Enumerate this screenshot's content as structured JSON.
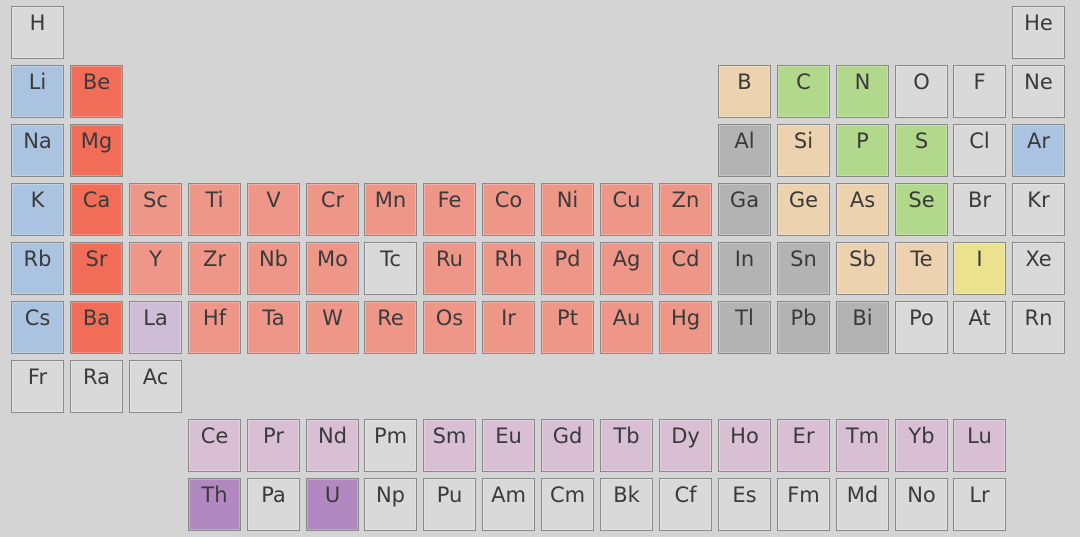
{
  "colors": {
    "none": "#d9d9d9",
    "alkali": "#a9c3e0",
    "alkaline_earth": "#f26d58",
    "transition": "#ee9688",
    "lanthanum": "#cfbcd6",
    "lanthanide": "#d9bfd4",
    "actinide_highlight": "#b288c0",
    "boron_group": "#ecd2af",
    "carbon_group": "#b2d88c",
    "metal_gray": "#b3b3b3",
    "halogen_yellow": "#eae28f",
    "noble_blue": "#a9c3e0"
  },
  "rows": [
    [
      [
        "H",
        "none"
      ],
      null,
      null,
      null,
      null,
      null,
      null,
      null,
      null,
      null,
      null,
      null,
      null,
      null,
      null,
      null,
      null,
      [
        "He",
        "none"
      ]
    ],
    [
      [
        "Li",
        "alkali"
      ],
      [
        "Be",
        "alkaline_earth"
      ],
      null,
      null,
      null,
      null,
      null,
      null,
      null,
      null,
      null,
      null,
      [
        "B",
        "boron_group"
      ],
      [
        "C",
        "carbon_group"
      ],
      [
        "N",
        "carbon_group"
      ],
      [
        "O",
        "none"
      ],
      [
        "F",
        "none"
      ],
      [
        "Ne",
        "none"
      ]
    ],
    [
      [
        "Na",
        "alkali"
      ],
      [
        "Mg",
        "alkaline_earth"
      ],
      null,
      null,
      null,
      null,
      null,
      null,
      null,
      null,
      null,
      null,
      [
        "Al",
        "metal_gray"
      ],
      [
        "Si",
        "boron_group"
      ],
      [
        "P",
        "carbon_group"
      ],
      [
        "S",
        "carbon_group"
      ],
      [
        "Cl",
        "none"
      ],
      [
        "Ar",
        "noble_blue"
      ]
    ],
    [
      [
        "K",
        "alkali"
      ],
      [
        "Ca",
        "alkaline_earth"
      ],
      [
        "Sc",
        "transition"
      ],
      [
        "Ti",
        "transition"
      ],
      [
        "V",
        "transition"
      ],
      [
        "Cr",
        "transition"
      ],
      [
        "Mn",
        "transition"
      ],
      [
        "Fe",
        "transition"
      ],
      [
        "Co",
        "transition"
      ],
      [
        "Ni",
        "transition"
      ],
      [
        "Cu",
        "transition"
      ],
      [
        "Zn",
        "transition"
      ],
      [
        "Ga",
        "metal_gray"
      ],
      [
        "Ge",
        "boron_group"
      ],
      [
        "As",
        "boron_group"
      ],
      [
        "Se",
        "carbon_group"
      ],
      [
        "Br",
        "none"
      ],
      [
        "Kr",
        "none"
      ]
    ],
    [
      [
        "Rb",
        "alkali"
      ],
      [
        "Sr",
        "alkaline_earth"
      ],
      [
        "Y",
        "transition"
      ],
      [
        "Zr",
        "transition"
      ],
      [
        "Nb",
        "transition"
      ],
      [
        "Mo",
        "transition"
      ],
      [
        "Tc",
        "none"
      ],
      [
        "Ru",
        "transition"
      ],
      [
        "Rh",
        "transition"
      ],
      [
        "Pd",
        "transition"
      ],
      [
        "Ag",
        "transition"
      ],
      [
        "Cd",
        "transition"
      ],
      [
        "In",
        "metal_gray"
      ],
      [
        "Sn",
        "metal_gray"
      ],
      [
        "Sb",
        "boron_group"
      ],
      [
        "Te",
        "boron_group"
      ],
      [
        "I",
        "halogen_yellow"
      ],
      [
        "Xe",
        "none"
      ]
    ],
    [
      [
        "Cs",
        "alkali"
      ],
      [
        "Ba",
        "alkaline_earth"
      ],
      [
        "La",
        "lanthanum"
      ],
      [
        "Hf",
        "transition"
      ],
      [
        "Ta",
        "transition"
      ],
      [
        "W",
        "transition"
      ],
      [
        "Re",
        "transition"
      ],
      [
        "Os",
        "transition"
      ],
      [
        "Ir",
        "transition"
      ],
      [
        "Pt",
        "transition"
      ],
      [
        "Au",
        "transition"
      ],
      [
        "Hg",
        "transition"
      ],
      [
        "Tl",
        "metal_gray"
      ],
      [
        "Pb",
        "metal_gray"
      ],
      [
        "Bi",
        "metal_gray"
      ],
      [
        "Po",
        "none"
      ],
      [
        "At",
        "none"
      ],
      [
        "Rn",
        "none"
      ]
    ],
    [
      [
        "Fr",
        "none"
      ],
      [
        "Ra",
        "none"
      ],
      [
        "Ac",
        "none"
      ],
      null,
      null,
      null,
      null,
      null,
      null,
      null,
      null,
      null,
      null,
      null,
      null,
      null,
      null,
      null
    ],
    [
      null,
      null,
      null,
      [
        "Ce",
        "lanthanide"
      ],
      [
        "Pr",
        "lanthanide"
      ],
      [
        "Nd",
        "lanthanide"
      ],
      [
        "Pm",
        "none"
      ],
      [
        "Sm",
        "lanthanide"
      ],
      [
        "Eu",
        "lanthanide"
      ],
      [
        "Gd",
        "lanthanide"
      ],
      [
        "Tb",
        "lanthanide"
      ],
      [
        "Dy",
        "lanthanide"
      ],
      [
        "Ho",
        "lanthanide"
      ],
      [
        "Er",
        "lanthanide"
      ],
      [
        "Tm",
        "lanthanide"
      ],
      [
        "Yb",
        "lanthanide"
      ],
      [
        "Lu",
        "lanthanide"
      ],
      null
    ],
    [
      null,
      null,
      null,
      [
        "Th",
        "actinide_highlight"
      ],
      [
        "Pa",
        "none"
      ],
      [
        "U",
        "actinide_highlight"
      ],
      [
        "Np",
        "none"
      ],
      [
        "Pu",
        "none"
      ],
      [
        "Am",
        "none"
      ],
      [
        "Cm",
        "none"
      ],
      [
        "Bk",
        "none"
      ],
      [
        "Cf",
        "none"
      ],
      [
        "Es",
        "none"
      ],
      [
        "Fm",
        "none"
      ],
      [
        "Md",
        "none"
      ],
      [
        "No",
        "none"
      ],
      [
        "Lr",
        "none"
      ],
      null
    ]
  ]
}
